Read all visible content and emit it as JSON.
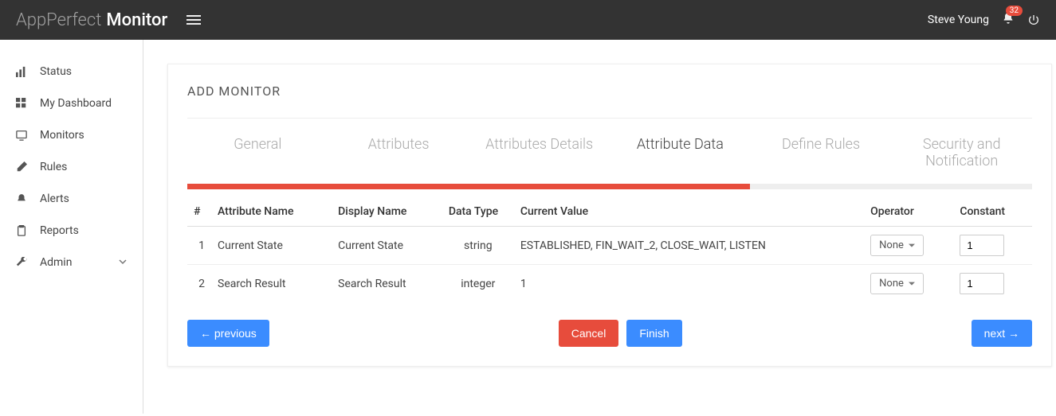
{
  "header": {
    "brand_prefix": "AppPerfect",
    "brand_strong": "Monitor",
    "user_name": "Steve Young",
    "notification_count": "32"
  },
  "sidebar": {
    "items": [
      {
        "label": "Status"
      },
      {
        "label": "My Dashboard"
      },
      {
        "label": "Monitors"
      },
      {
        "label": "Rules"
      },
      {
        "label": "Alerts"
      },
      {
        "label": "Reports"
      },
      {
        "label": "Admin"
      }
    ]
  },
  "panel": {
    "title": "ADD MONITOR",
    "tabs": [
      {
        "label": "General"
      },
      {
        "label": "Attributes"
      },
      {
        "label": "Attributes Details"
      },
      {
        "label": "Attribute Data"
      },
      {
        "label": "Define Rules"
      },
      {
        "label": "Security and Notification"
      }
    ],
    "progress_percent": 66.6,
    "table": {
      "headers": {
        "num": "#",
        "attr_name": "Attribute Name",
        "display_name": "Display Name",
        "data_type": "Data Type",
        "current_value": "Current Value",
        "operator": "Operator",
        "constant": "Constant"
      },
      "rows": [
        {
          "num": "1",
          "attr_name": "Current State",
          "display_name": "Current State",
          "data_type": "string",
          "current_value": "ESTABLISHED, FIN_WAIT_2, CLOSE_WAIT, LISTEN",
          "operator": "None",
          "constant": "1"
        },
        {
          "num": "2",
          "attr_name": "Search Result",
          "display_name": "Search Result",
          "data_type": "integer",
          "current_value": "1",
          "operator": "None",
          "constant": "1"
        }
      ]
    },
    "buttons": {
      "previous": "← previous",
      "cancel": "Cancel",
      "finish": "Finish",
      "next": "next →"
    }
  }
}
